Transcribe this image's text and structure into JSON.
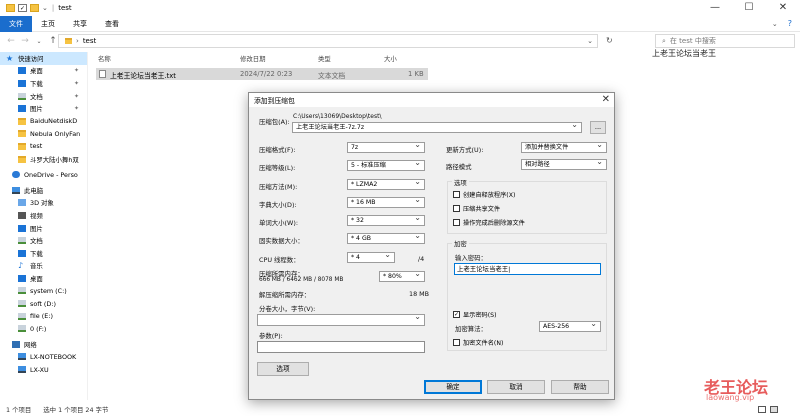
{
  "titlebar": {
    "title": "test",
    "minimize": "—",
    "maximize": "☐",
    "close": "✕"
  },
  "ribbon": {
    "file": "文件",
    "home": "主页",
    "share": "共享",
    "view": "查看"
  },
  "addressbar": {
    "path": "test",
    "search_placeholder": "在 test 中搜索"
  },
  "sidebar": {
    "items": [
      {
        "label": "快速访问"
      },
      {
        "label": "桌面"
      },
      {
        "label": "下载"
      },
      {
        "label": "文档"
      },
      {
        "label": "图片"
      },
      {
        "label": "BaiduNetdiskD"
      },
      {
        "label": "Nebula OnlyFan"
      },
      {
        "label": "test"
      },
      {
        "label": "斗罗大陆小舞h双"
      },
      {
        "label": "OneDrive - Perso"
      },
      {
        "label": "此电脑"
      },
      {
        "label": "3D 对象"
      },
      {
        "label": "视频"
      },
      {
        "label": "图片"
      },
      {
        "label": "文档"
      },
      {
        "label": "下载"
      },
      {
        "label": "音乐"
      },
      {
        "label": "桌面"
      },
      {
        "label": "system (C:)"
      },
      {
        "label": "soft (D:)"
      },
      {
        "label": "file (E:)"
      },
      {
        "label": "0 (F:)"
      },
      {
        "label": "网络"
      },
      {
        "label": "LX-NOTEBOOK"
      },
      {
        "label": "LX-XU"
      }
    ]
  },
  "filelist": {
    "columns": {
      "name": "名称",
      "date": "修改日期",
      "type": "类型",
      "size": "大小"
    },
    "files": [
      {
        "name": "上老王论坛当老王.txt",
        "date": "2024/7/22 0:23",
        "type": "文本文档",
        "size": "1 KB"
      }
    ]
  },
  "preview": {
    "text": "上老王论坛当老王"
  },
  "statusbar": {
    "count": "1 个项目",
    "selected": "选中 1 个项目  24 字节"
  },
  "dialog": {
    "title": "添加到压缩包",
    "archive_label": "压缩包(A):",
    "archive_dir": "C:\\Users\\13069\\Desktop\\test\\",
    "archive_name": "上老王论坛当老王-7z.7z",
    "browse": "...",
    "format_label": "压缩格式(F):",
    "format_value": "7z",
    "level_label": "压缩等级(L):",
    "level_value": "5 - 标准压缩",
    "method_label": "压缩方法(M):",
    "method_value": "* LZMA2",
    "dict_label": "字典大小(D):",
    "dict_value": "* 16 MB",
    "word_label": "单词大小(W):",
    "word_value": "* 32",
    "solid_label": "固实数据大小：",
    "solid_value": "* 4 GB",
    "threads_label": "CPU 线程数：",
    "threads_value": "* 4",
    "threads_total": "/4",
    "mem_label": "压缩所需内存：",
    "mem_detail": "666 MB / 6462 MB / 8078 MB",
    "mem_percent": "* 80%",
    "decomp_label": "解压缩所需内存：",
    "decomp_value": "18 MB",
    "split_label": "分卷大小，字节(V):",
    "params_label": "参数(P):",
    "options_btn": "选项",
    "update_label": "更新方式(U):",
    "update_value": "添加并替换文件",
    "path_label": "路径模式",
    "path_value": "相对路径",
    "options_group": "选项",
    "opt_sfx": "创建自释放程序(X)",
    "opt_shared": "压缩共享文件",
    "opt_delete": "操作完成后删除源文件",
    "enc_group": "加密",
    "pwd_label": "输入密码：",
    "pwd_value": "上老王论坛当老王|",
    "show_pwd": "显示密码(S)",
    "enc_method_label": "加密算法：",
    "enc_method_value": "AES-256",
    "enc_names": "加密文件名(N)",
    "ok": "确定",
    "cancel": "取消",
    "help": "帮助"
  },
  "watermark": {
    "title": "老王论坛",
    "url": "laowang.vip"
  }
}
